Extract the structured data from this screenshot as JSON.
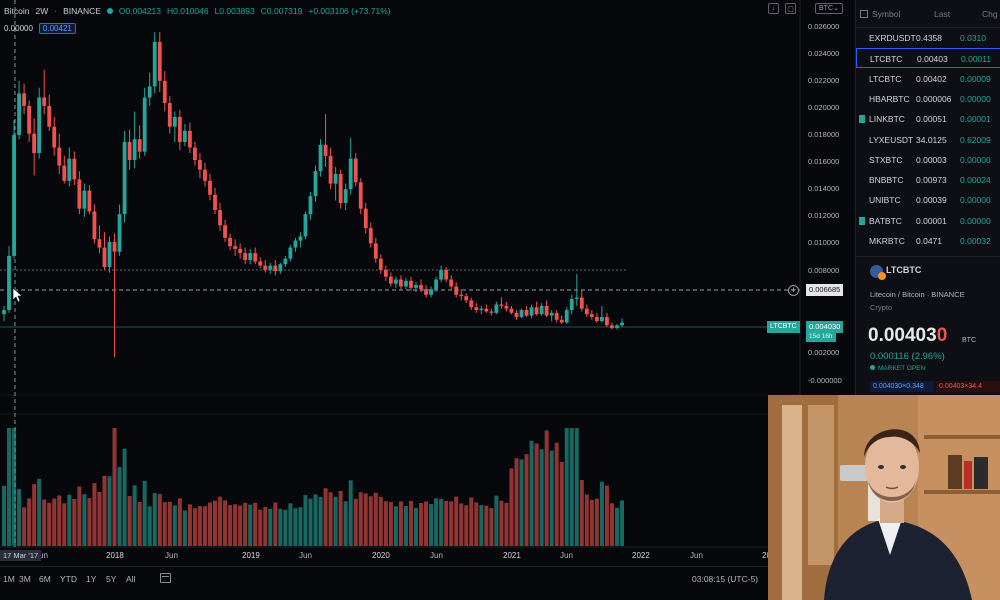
{
  "legend": {
    "symbol": "Bitcoin",
    "interval": "2W",
    "exchange": "BINANCE",
    "open": "O0.004213",
    "high": "H0.010046",
    "low": "L0.003893",
    "close": "C0.007319",
    "change": "+0.003106 (+73.71%)"
  },
  "indicator": {
    "value_a": "0.00000",
    "value_b": "0.00421"
  },
  "toolbar_right": {
    "currency": "BTC"
  },
  "price_axis": {
    "labels": [
      "0.026000",
      "0.024000",
      "0.022000",
      "0.020000",
      "0.018000",
      "0.016000",
      "0.014000",
      "0.012000",
      "0.010000",
      "0.008000",
      "0.004000",
      "0.002000",
      "-0.000000"
    ],
    "crosshair_price": "0.006685",
    "last_price": "0.004030",
    "countdown": "15d 16h",
    "symbol_flag": "LTCBTC"
  },
  "time_axis": {
    "first_label": "17 Mar '17",
    "labels": [
      "Jun",
      "2018",
      "Jun",
      "2019",
      "Jun",
      "2020",
      "Jun",
      "2021",
      "Jun",
      "2022",
      "Jun",
      "20"
    ]
  },
  "bottom_bar": {
    "ranges": [
      "1M",
      "3M",
      "6M",
      "YTD",
      "1Y",
      "5Y",
      "All"
    ],
    "clock": "03:08:15 (UTC-5)"
  },
  "watchlist": {
    "headers": {
      "symbol": "Symbol",
      "last": "Last",
      "chg": "Chg"
    },
    "rows": [
      {
        "symbol": "EXRDUSDT",
        "last": "0.4358",
        "chg": "0.0310"
      },
      {
        "symbol": "LTCBTC",
        "last": "0.00403",
        "chg": "0.00011"
      },
      {
        "symbol": "LTCBTC",
        "last": "0.00402",
        "chg": "0.00009"
      },
      {
        "symbol": "HBARBTC",
        "last": "0.000006",
        "chg": "0.00000"
      },
      {
        "symbol": "LINKBTC",
        "last": "0.00051",
        "chg": "0.00001"
      },
      {
        "symbol": "LYXEUSDT",
        "last": "34.0125",
        "chg": "0.62009"
      },
      {
        "symbol": "STXBTC",
        "last": "0.00003",
        "chg": "0.00000"
      },
      {
        "symbol": "BNBBTC",
        "last": "0.00973",
        "chg": "0.00024"
      },
      {
        "symbol": "UNIBTC",
        "last": "0.00039",
        "chg": "0.00000"
      },
      {
        "symbol": "BATBTC",
        "last": "0.00001",
        "chg": "0.00000"
      },
      {
        "symbol": "MKRBTC",
        "last": "0.0471",
        "chg": "0.00032"
      }
    ]
  },
  "detail": {
    "symbol": "LTCBTC",
    "description": "Litecoin / Bitcoin · BINANCE",
    "type": "Crypto",
    "price_main": "0.00403",
    "price_tail": "0",
    "currency": "BTC",
    "change": "0.000116 (2.96%)",
    "market": "MARKET OPEN",
    "bid": "0.004030×0.348",
    "ask": "0.00403×34.4"
  },
  "colors": {
    "up": "#26a69a",
    "down": "#ef5350",
    "accent": "#2962ff"
  },
  "chart_data": {
    "type": "candlestick",
    "price_range": [
      -0.001,
      0.0265
    ],
    "candles": [
      [
        0.0046,
        0.0052,
        0.0041,
        0.0049
      ],
      [
        0.0049,
        0.0095,
        0.0047,
        0.0088
      ],
      [
        0.0088,
        0.0186,
        0.0086,
        0.0175
      ],
      [
        0.0175,
        0.0214,
        0.0172,
        0.0205
      ],
      [
        0.0205,
        0.0212,
        0.019,
        0.0196
      ],
      [
        0.0196,
        0.02,
        0.017,
        0.0176
      ],
      [
        0.0176,
        0.0187,
        0.0146,
        0.0162
      ],
      [
        0.0162,
        0.0209,
        0.0158,
        0.0202
      ],
      [
        0.0202,
        0.0222,
        0.019,
        0.0196
      ],
      [
        0.0196,
        0.0204,
        0.0178,
        0.0181
      ],
      [
        0.0181,
        0.0188,
        0.016,
        0.0166
      ],
      [
        0.0166,
        0.0176,
        0.0147,
        0.0153
      ],
      [
        0.0153,
        0.016,
        0.014,
        0.0142
      ],
      [
        0.0142,
        0.0166,
        0.0138,
        0.0158
      ],
      [
        0.0158,
        0.0163,
        0.0139,
        0.0143
      ],
      [
        0.0143,
        0.0149,
        0.0118,
        0.0122
      ],
      [
        0.0122,
        0.014,
        0.0116,
        0.0135
      ],
      [
        0.0135,
        0.0139,
        0.0118,
        0.012
      ],
      [
        0.012,
        0.0125,
        0.0097,
        0.01
      ],
      [
        0.01,
        0.011,
        0.009,
        0.0094
      ],
      [
        0.0094,
        0.0105,
        0.0078,
        0.008
      ],
      [
        0.008,
        0.0102,
        0.0076,
        0.0098
      ],
      [
        0.0098,
        0.0104,
        0.0015,
        0.0091
      ],
      [
        0.0091,
        0.0125,
        0.0088,
        0.0118
      ],
      [
        0.0118,
        0.0178,
        0.0112,
        0.017
      ],
      [
        0.017,
        0.0179,
        0.015,
        0.0157
      ],
      [
        0.0157,
        0.0192,
        0.0151,
        0.0172
      ],
      [
        0.0172,
        0.0182,
        0.0158,
        0.0163
      ],
      [
        0.0163,
        0.0209,
        0.016,
        0.0202
      ],
      [
        0.0202,
        0.022,
        0.0196,
        0.021
      ],
      [
        0.021,
        0.0249,
        0.0205,
        0.0242
      ],
      [
        0.0242,
        0.0249,
        0.0206,
        0.0214
      ],
      [
        0.0214,
        0.0221,
        0.0192,
        0.0198
      ],
      [
        0.0198,
        0.0203,
        0.0176,
        0.0181
      ],
      [
        0.0181,
        0.0192,
        0.017,
        0.0188
      ],
      [
        0.0188,
        0.0193,
        0.0164,
        0.017
      ],
      [
        0.017,
        0.0183,
        0.0167,
        0.0178
      ],
      [
        0.0178,
        0.0184,
        0.0162,
        0.0166
      ],
      [
        0.0166,
        0.017,
        0.0153,
        0.0157
      ],
      [
        0.0157,
        0.0162,
        0.0144,
        0.015
      ],
      [
        0.015,
        0.0155,
        0.0138,
        0.0142
      ],
      [
        0.0142,
        0.0147,
        0.0128,
        0.0132
      ],
      [
        0.0132,
        0.0137,
        0.0118,
        0.0121
      ],
      [
        0.0121,
        0.0126,
        0.0106,
        0.011
      ],
      [
        0.011,
        0.0114,
        0.0098,
        0.0101
      ],
      [
        0.0101,
        0.0104,
        0.0092,
        0.0095
      ],
      [
        0.0095,
        0.01,
        0.0088,
        0.0093
      ],
      [
        0.0093,
        0.0097,
        0.0086,
        0.009
      ],
      [
        0.009,
        0.0094,
        0.0082,
        0.0085
      ],
      [
        0.0085,
        0.0093,
        0.0082,
        0.009
      ],
      [
        0.009,
        0.0094,
        0.0082,
        0.0084
      ],
      [
        0.0084,
        0.0087,
        0.0079,
        0.0081
      ],
      [
        0.0081,
        0.0085,
        0.0076,
        0.0078
      ],
      [
        0.0078,
        0.0083,
        0.0075,
        0.0081
      ],
      [
        0.0081,
        0.0085,
        0.0074,
        0.0077
      ],
      [
        0.0077,
        0.0083,
        0.0075,
        0.0082
      ],
      [
        0.0082,
        0.0088,
        0.008,
        0.0086
      ],
      [
        0.0086,
        0.0096,
        0.0084,
        0.0094
      ],
      [
        0.0094,
        0.0101,
        0.0091,
        0.0099
      ],
      [
        0.0099,
        0.0105,
        0.0094,
        0.0102
      ],
      [
        0.0102,
        0.012,
        0.01,
        0.0118
      ],
      [
        0.0118,
        0.0134,
        0.0114,
        0.0131
      ],
      [
        0.0131,
        0.0153,
        0.0127,
        0.0149
      ],
      [
        0.0149,
        0.0172,
        0.0145,
        0.0168
      ],
      [
        0.0168,
        0.019,
        0.0152,
        0.016
      ],
      [
        0.016,
        0.0166,
        0.0136,
        0.014
      ],
      [
        0.014,
        0.0152,
        0.0128,
        0.0147
      ],
      [
        0.0147,
        0.015,
        0.0122,
        0.0126
      ],
      [
        0.0126,
        0.014,
        0.0121,
        0.0136
      ],
      [
        0.0136,
        0.0173,
        0.0132,
        0.0158
      ],
      [
        0.0158,
        0.0162,
        0.0138,
        0.0141
      ],
      [
        0.0141,
        0.0144,
        0.0118,
        0.0122
      ],
      [
        0.0122,
        0.0126,
        0.0104,
        0.0108
      ],
      [
        0.0108,
        0.0112,
        0.0094,
        0.0097
      ],
      [
        0.0097,
        0.0101,
        0.0083,
        0.0086
      ],
      [
        0.0086,
        0.0089,
        0.0075,
        0.0078
      ],
      [
        0.0078,
        0.0081,
        0.007,
        0.0073
      ],
      [
        0.0073,
        0.0076,
        0.0066,
        0.0068
      ],
      [
        0.0068,
        0.0073,
        0.0065,
        0.0071
      ],
      [
        0.0071,
        0.0074,
        0.0064,
        0.0066
      ],
      [
        0.0066,
        0.0072,
        0.0064,
        0.007
      ],
      [
        0.007,
        0.0073,
        0.0063,
        0.0065
      ],
      [
        0.0065,
        0.0069,
        0.0062,
        0.0067
      ],
      [
        0.0067,
        0.0071,
        0.0062,
        0.0064
      ],
      [
        0.0064,
        0.0067,
        0.0058,
        0.006
      ],
      [
        0.006,
        0.0066,
        0.0058,
        0.0064
      ],
      [
        0.0064,
        0.0073,
        0.0062,
        0.0071
      ],
      [
        0.0071,
        0.0081,
        0.0069,
        0.0078
      ],
      [
        0.0078,
        0.008,
        0.0069,
        0.0071
      ],
      [
        0.0071,
        0.0074,
        0.0064,
        0.0066
      ],
      [
        0.0066,
        0.0069,
        0.0058,
        0.006
      ],
      [
        0.006,
        0.0064,
        0.0056,
        0.0059
      ],
      [
        0.0059,
        0.0061,
        0.0054,
        0.0056
      ],
      [
        0.0056,
        0.0058,
        0.0049,
        0.0051
      ],
      [
        0.0051,
        0.0054,
        0.0047,
        0.0049
      ],
      [
        0.0049,
        0.0052,
        0.0046,
        0.005
      ],
      [
        0.005,
        0.0053,
        0.0047,
        0.0048
      ],
      [
        0.0048,
        0.005,
        0.0045,
        0.0047
      ],
      [
        0.0047,
        0.0055,
        0.0046,
        0.0053
      ],
      [
        0.0053,
        0.0058,
        0.005,
        0.0052
      ],
      [
        0.0052,
        0.0055,
        0.0048,
        0.005
      ],
      [
        0.005,
        0.0052,
        0.0046,
        0.0047
      ],
      [
        0.0047,
        0.0049,
        0.0042,
        0.0044
      ],
      [
        0.0044,
        0.005,
        0.0043,
        0.0049
      ],
      [
        0.0049,
        0.0052,
        0.0044,
        0.0045
      ],
      [
        0.0045,
        0.0053,
        0.0043,
        0.0051
      ],
      [
        0.0051,
        0.0055,
        0.0045,
        0.0046
      ],
      [
        0.0046,
        0.0054,
        0.0045,
        0.0052
      ],
      [
        0.0052,
        0.0056,
        0.0044,
        0.0045
      ],
      [
        0.0045,
        0.0049,
        0.0041,
        0.0047
      ],
      [
        0.0047,
        0.0049,
        0.004,
        0.0042
      ],
      [
        0.0042,
        0.0045,
        0.0039,
        0.004
      ],
      [
        0.004,
        0.0051,
        0.0039,
        0.0049
      ],
      [
        0.0049,
        0.006,
        0.0046,
        0.0057
      ],
      [
        0.0057,
        0.0075,
        0.0052,
        0.0058
      ],
      [
        0.0058,
        0.0063,
        0.0048,
        0.005
      ],
      [
        0.005,
        0.0053,
        0.0044,
        0.0046
      ],
      [
        0.0046,
        0.0049,
        0.0042,
        0.0044
      ],
      [
        0.0044,
        0.0047,
        0.004,
        0.0041
      ],
      [
        0.0041,
        0.0052,
        0.004,
        0.0044
      ],
      [
        0.0044,
        0.0047,
        0.0037,
        0.0038
      ],
      [
        0.0038,
        0.004,
        0.0035,
        0.0036
      ],
      [
        0.0036,
        0.0039,
        0.0035,
        0.0038
      ],
      [
        0.0038,
        0.0043,
        0.0037,
        0.004
      ]
    ]
  }
}
